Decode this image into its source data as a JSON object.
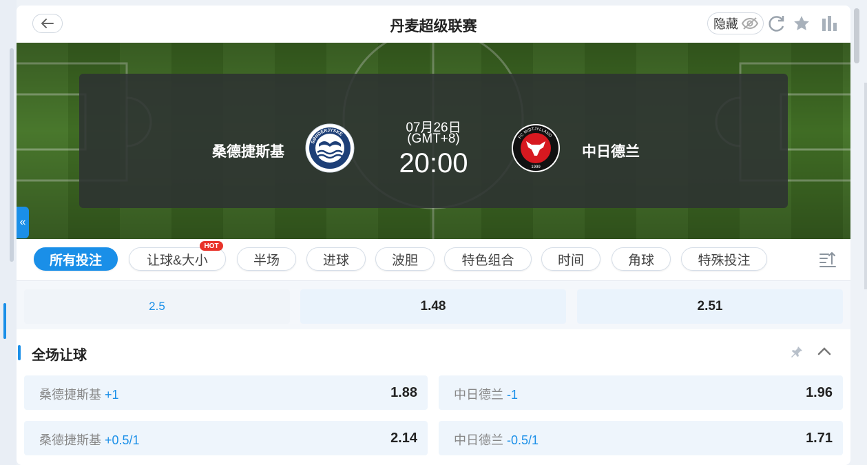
{
  "header": {
    "title": "丹麦超级联赛",
    "hide_label": "隐藏"
  },
  "match": {
    "home_team": "桑德捷斯基",
    "away_team": "中日德兰",
    "date": "07月26日",
    "timezone": "(GMT+8)",
    "time": "20:00",
    "home_crest_text_top": "SØNDERJYSKE",
    "away_crest_text": "FC MIDTJYLLAND",
    "away_crest_year": "1999"
  },
  "tabs": [
    {
      "label": "所有投注",
      "active": true
    },
    {
      "label": "让球&大小",
      "badge": "HOT"
    },
    {
      "label": "半场"
    },
    {
      "label": "进球"
    },
    {
      "label": "波胆"
    },
    {
      "label": "特色组合"
    },
    {
      "label": "时间"
    },
    {
      "label": "角球"
    },
    {
      "label": "特殊投注"
    }
  ],
  "odds_row": {
    "line": "2.5",
    "over": "1.48",
    "under": "2.51"
  },
  "section": {
    "title": "全场让球",
    "bets": [
      {
        "team": "桑德捷斯基",
        "handicap": "+1",
        "odds": "1.88"
      },
      {
        "team": "中日德兰",
        "handicap": "-1",
        "odds": "1.96"
      },
      {
        "team": "桑德捷斯基",
        "handicap": "+0.5/1",
        "odds": "2.14"
      },
      {
        "team": "中日德兰",
        "handicap": "-0.5/1",
        "odds": "1.71"
      }
    ]
  },
  "colors": {
    "accent": "#1a8fe8",
    "hot": "#e8332a",
    "pitch": "#4d7e2f"
  },
  "icons": [
    "back-arrow-icon",
    "eye-off-icon",
    "refresh-icon",
    "star-icon",
    "stats-icon",
    "collapse-left-icon",
    "sort-icon",
    "pin-icon",
    "chevron-up-icon"
  ]
}
